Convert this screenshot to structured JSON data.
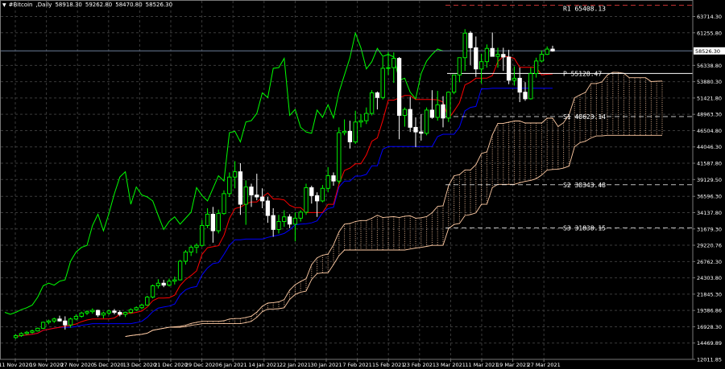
{
  "header": {
    "symbol": "#Bitcoin",
    "timeframe": "Daily",
    "open": "58918.30",
    "high": "59262.80",
    "low": "58470.80",
    "close": "58526.30"
  },
  "chart_data": {
    "type": "candlestick",
    "ylim": [
      12011.85,
      66200
    ],
    "y_ticks": [
      "12011.85",
      "14469.89",
      "16928.30",
      "19386.86",
      "21845.30",
      "24303.80",
      "26762.30",
      "29220.76",
      "31679.30",
      "34137.80",
      "36596.30",
      "39129.50",
      "41587.80",
      "44046.30",
      "46504.80",
      "48963.30",
      "51421.80",
      "53880.30",
      "56338.80",
      "61255.80",
      "63714.30"
    ],
    "x_labels": [
      "11 Nov 2020",
      "19 Nov 2020",
      "27 Nov 2020",
      "5 Dec 2020",
      "13 Dec 2020",
      "21 Dec 2020",
      "29 Dec 2020",
      "6 Jan 2021",
      "14 Jan 2021",
      "22 Jan 2021",
      "30 Jan 2021",
      "7 Feb 2021",
      "15 Feb 2021",
      "23 Feb 2021",
      "3 Mar 2021",
      "11 Mar 2021",
      "19 Mar 2021",
      "27 Mar 2021"
    ],
    "grid": true,
    "current_price": "58526.30",
    "pivots": [
      {
        "label": "R1",
        "value": "65408.13"
      },
      {
        "label": "P",
        "value": "55128.47"
      },
      {
        "label": "S1",
        "value": "48623.14"
      },
      {
        "label": "S2",
        "value": "38343.48"
      },
      {
        "label": "S3",
        "value": "31838.15"
      }
    ],
    "colors": {
      "bull": "#00ff00",
      "bear": "#ffffff",
      "tenkan": "#ff0000",
      "kijun": "#0000ff",
      "chikou": "#00ff00",
      "cloud": "#ffcba4",
      "grid": "#3a3a3a",
      "pivot": "#ffffff",
      "r1_line": "#ff4040",
      "current_line": "#6b7d99"
    },
    "candles": [
      [
        15300,
        15800,
        15100,
        15600
      ],
      [
        15600,
        16100,
        15400,
        15900
      ],
      [
        15900,
        16300,
        15700,
        16100
      ],
      [
        16100,
        16500,
        15900,
        16300
      ],
      [
        16300,
        16800,
        16200,
        16700
      ],
      [
        16700,
        17700,
        16600,
        17600
      ],
      [
        17600,
        18000,
        17300,
        17800
      ],
      [
        17800,
        18300,
        17500,
        18100
      ],
      [
        18100,
        18600,
        17700,
        17800
      ],
      [
        17800,
        18500,
        16500,
        17200
      ],
      [
        17200,
        18300,
        16800,
        18100
      ],
      [
        18100,
        18800,
        17900,
        18500
      ],
      [
        18500,
        19200,
        18300,
        19000
      ],
      [
        19000,
        19400,
        18700,
        19200
      ],
      [
        19200,
        19700,
        18900,
        19400
      ],
      [
        19400,
        19500,
        18400,
        18700
      ],
      [
        18700,
        19200,
        18200,
        19000
      ],
      [
        19000,
        19500,
        18700,
        19300
      ],
      [
        19300,
        19600,
        18800,
        19100
      ],
      [
        19100,
        19400,
        18500,
        18800
      ],
      [
        18800,
        19200,
        18400,
        19100
      ],
      [
        19100,
        19700,
        18900,
        19500
      ],
      [
        19500,
        20000,
        19300,
        19800
      ],
      [
        19800,
        20400,
        19600,
        20200
      ],
      [
        20200,
        21600,
        20100,
        21400
      ],
      [
        21400,
        23300,
        21200,
        23100
      ],
      [
        23100,
        24100,
        22700,
        23500
      ],
      [
        23500,
        24000,
        22900,
        23200
      ],
      [
        23200,
        24200,
        23000,
        23800
      ],
      [
        23800,
        24500,
        23300,
        24000
      ],
      [
        24000,
        27000,
        23900,
        26800
      ],
      [
        26800,
        28500,
        26300,
        28200
      ],
      [
        28200,
        29200,
        27600,
        28900
      ],
      [
        28900,
        29500,
        28000,
        29200
      ],
      [
        29200,
        33000,
        29000,
        32200
      ],
      [
        32200,
        34800,
        31800,
        33900
      ],
      [
        33900,
        35000,
        29600,
        31400
      ],
      [
        31400,
        34600,
        31000,
        34000
      ],
      [
        34000,
        37500,
        33800,
        37000
      ],
      [
        37000,
        40200,
        36500,
        39500
      ],
      [
        39500,
        41900,
        37800,
        40300
      ],
      [
        40300,
        41600,
        33800,
        35400
      ],
      [
        35400,
        39000,
        32300,
        38000
      ],
      [
        38000,
        38500,
        35000,
        36800
      ],
      [
        36800,
        40000,
        36000,
        36500
      ],
      [
        36500,
        37800,
        34800,
        35900
      ],
      [
        35900,
        36500,
        32600,
        33700
      ],
      [
        33700,
        34800,
        30500,
        31600
      ],
      [
        31600,
        33800,
        31000,
        32800
      ],
      [
        32800,
        34500,
        32000,
        33500
      ],
      [
        33500,
        33900,
        31800,
        32400
      ],
      [
        32400,
        34200,
        29800,
        33300
      ],
      [
        33300,
        34500,
        32800,
        34200
      ],
      [
        34200,
        38500,
        33800,
        37900
      ],
      [
        37900,
        38200,
        35500,
        36700
      ],
      [
        36700,
        37200,
        33500,
        35900
      ],
      [
        35900,
        38300,
        35700,
        37800
      ],
      [
        37800,
        41000,
        37200,
        39700
      ],
      [
        39700,
        40200,
        38200,
        38900
      ],
      [
        38900,
        47000,
        38500,
        46200
      ],
      [
        46200,
        48200,
        45800,
        46400
      ],
      [
        46400,
        48000,
        43800,
        44800
      ],
      [
        44800,
        49500,
        44500,
        47800
      ],
      [
        47800,
        49000,
        47000,
        48000
      ],
      [
        48000,
        50000,
        47500,
        49100
      ],
      [
        49100,
        52600,
        48800,
        52200
      ],
      [
        52200,
        52400,
        49700,
        51500
      ],
      [
        51500,
        57600,
        51200,
        55900
      ],
      [
        55900,
        58400,
        54900,
        56000
      ],
      [
        56000,
        58300,
        53700,
        57400
      ],
      [
        57400,
        57600,
        45200,
        48800
      ],
      [
        48800,
        50000,
        47100,
        49700
      ],
      [
        49700,
        51600,
        46300,
        47000
      ],
      [
        47000,
        48500,
        44000,
        46300
      ],
      [
        46300,
        49000,
        45000,
        46100
      ],
      [
        46100,
        50000,
        45800,
        49600
      ],
      [
        49600,
        52600,
        48300,
        48500
      ],
      [
        48500,
        52500,
        48000,
        50400
      ],
      [
        50400,
        51700,
        47000,
        48400
      ],
      [
        48400,
        52400,
        47800,
        52300
      ],
      [
        52300,
        54900,
        52000,
        54900
      ],
      [
        54900,
        57400,
        53800,
        57500
      ],
      [
        57500,
        61800,
        55500,
        61200
      ],
      [
        61200,
        61500,
        56400,
        59000
      ],
      [
        59000,
        60700,
        54600,
        55800
      ],
      [
        55800,
        58100,
        53600,
        56900
      ],
      [
        56900,
        59500,
        56000,
        58900
      ],
      [
        58900,
        61300,
        57700,
        57700
      ],
      [
        57700,
        59000,
        56000,
        58000
      ],
      [
        58000,
        59000,
        55500,
        57600
      ],
      [
        57600,
        58700,
        53500,
        54100
      ],
      [
        54100,
        56200,
        53300,
        54400
      ],
      [
        54400,
        56000,
        50800,
        52300
      ],
      [
        52300,
        53800,
        51000,
        51300
      ],
      [
        51300,
        56000,
        51200,
        55100
      ],
      [
        55100,
        57500,
        54500,
        57000
      ],
      [
        57000,
        58600,
        56800,
        58000
      ],
      [
        58000,
        59200,
        57900,
        58800
      ],
      [
        58800,
        59300,
        58400,
        58500
      ]
    ]
  }
}
